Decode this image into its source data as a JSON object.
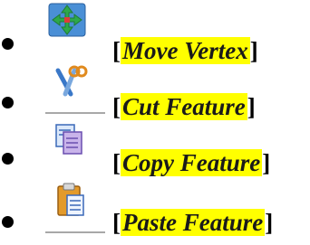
{
  "list": {
    "items": [
      {
        "icon": "move-vertex-icon",
        "open": "[",
        "label": "Move Vertex",
        "close": "]"
      },
      {
        "icon": "scissors-icon",
        "open": "[",
        "label": "Cut Feature",
        "close": "]"
      },
      {
        "icon": "copy-icon",
        "open": "[",
        "label": "Copy Feature",
        "close": "]"
      },
      {
        "icon": "paste-icon",
        "open": "[",
        "label": "Paste Feature",
        "close": "]"
      }
    ]
  },
  "colors": {
    "highlight": "#ffff00",
    "text": "#1a1a1a",
    "move_icon_bg": "#4a8fd6",
    "arrow_green": "#2ea84a"
  }
}
